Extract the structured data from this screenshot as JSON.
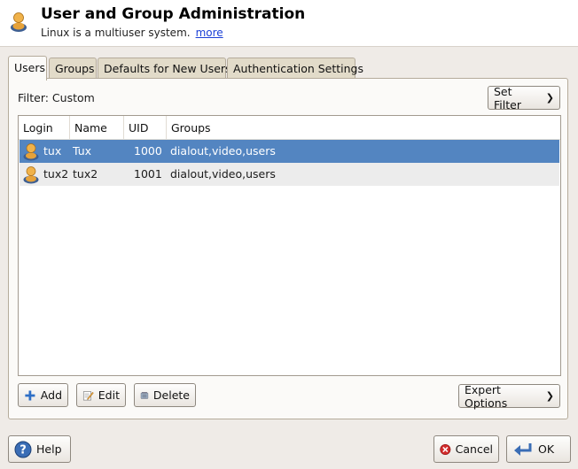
{
  "header": {
    "title": "User and Group Administration",
    "subtitle": "Linux is a multiuser system.",
    "more_link": "more"
  },
  "tabs": [
    {
      "label": "Users",
      "active": true
    },
    {
      "label": "Groups",
      "active": false
    },
    {
      "label": "Defaults for New Users",
      "active": false
    },
    {
      "label": "Authentication Settings",
      "active": false
    }
  ],
  "filter": {
    "label": "Filter: Custom",
    "button": "Set Filter"
  },
  "table": {
    "columns": [
      "Login",
      "Name",
      "UID",
      "Groups"
    ],
    "rows": [
      {
        "login": "tux",
        "name": "Tux",
        "uid": "1000",
        "groups": "dialout,video,users",
        "selected": true
      },
      {
        "login": "tux2",
        "name": "tux2",
        "uid": "1001",
        "groups": "dialout,video,users",
        "selected": false
      }
    ]
  },
  "actions": {
    "add": "Add",
    "edit": "Edit",
    "delete": "Delete",
    "expert": "Expert Options"
  },
  "footer": {
    "help": "Help",
    "cancel": "Cancel",
    "ok": "OK"
  },
  "colors": {
    "selection": "#5385c1",
    "link": "#1a3fd6",
    "window_bg": "#efebe7"
  }
}
